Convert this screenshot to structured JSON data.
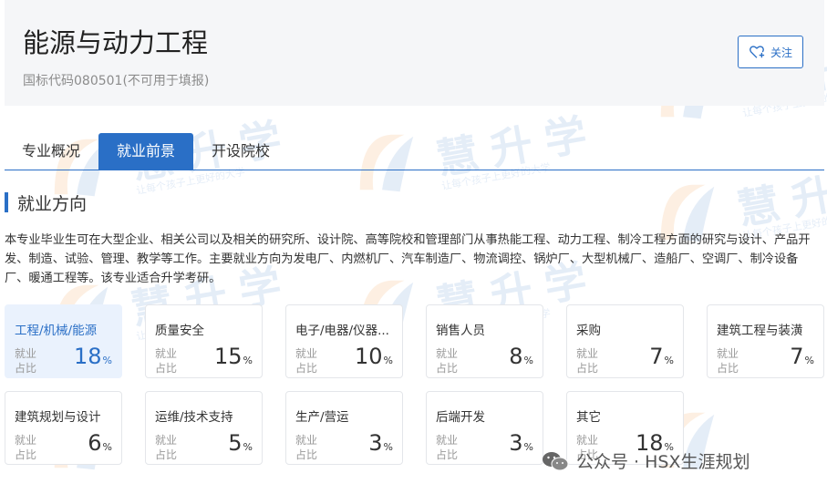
{
  "page": {
    "title": "能源与动力工程",
    "code": "国标代码080501(不可用于填报)",
    "follow_label": "关注"
  },
  "tabs": [
    {
      "label": "专业概况",
      "active": false
    },
    {
      "label": "就业前景",
      "active": true
    },
    {
      "label": "开设院校",
      "active": false
    }
  ],
  "section": {
    "title": "就业方向",
    "description": "本专业毕业生可在大型企业、相关公司以及相关的研究所、设计院、高等院校和管理部门从事热能工程、动力工程、制冷工程方面的研究与设计、产品开发、制造、试验、管理、教学等工作。主要就业方向为发电厂、内燃机厂、汽车制造厂、物流调控、锅炉厂、大型机械厂、造船厂、空调厂、制冷设备厂、暖通工程等。该专业适合升学考研。"
  },
  "cards": [
    {
      "name": "工程/机械/能源",
      "label": "就业占比",
      "value": "18",
      "unit": "%"
    },
    {
      "name": "质量安全",
      "label": "就业占比",
      "value": "15",
      "unit": "%"
    },
    {
      "name": "电子/电器/仪器...",
      "label": "就业占比",
      "value": "10",
      "unit": "%"
    },
    {
      "name": "销售人员",
      "label": "就业占比",
      "value": "8",
      "unit": "%"
    },
    {
      "name": "采购",
      "label": "就业占比",
      "value": "7",
      "unit": "%"
    },
    {
      "name": "建筑工程与装潢",
      "label": "就业占比",
      "value": "7",
      "unit": "%"
    },
    {
      "name": "建筑规划与设计",
      "label": "就业占比",
      "value": "6",
      "unit": "%"
    },
    {
      "name": "运维/技术支持",
      "label": "就业占比",
      "value": "5",
      "unit": "%"
    },
    {
      "name": "生产/营运",
      "label": "就业占比",
      "value": "3",
      "unit": "%"
    },
    {
      "name": "后端开发",
      "label": "就业占比",
      "value": "3",
      "unit": "%"
    },
    {
      "name": "其它",
      "label": "就业占比",
      "value": "18",
      "unit": "%"
    }
  ],
  "watermark": {
    "brand": "慧升学",
    "slogan": "让每个孩子上更好的大学"
  },
  "credit": {
    "text": "公众号 · HSX生涯规划"
  },
  "colors": {
    "accent": "#2a6fc6",
    "active_card_bg": "#eaf2fd",
    "header_bg": "#f5f6f8"
  }
}
